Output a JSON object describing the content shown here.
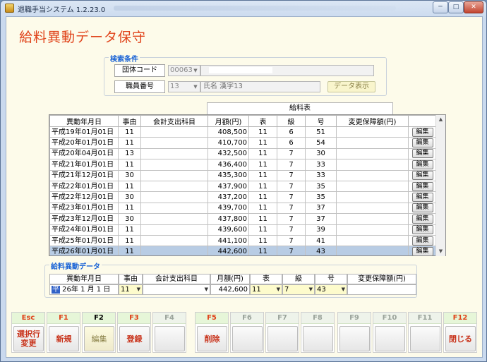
{
  "window": {
    "title": "退職手当システム 1.2.23.0",
    "close_glyph": "✕",
    "min_glyph": "─",
    "max_glyph": "□"
  },
  "page_title": "給料異動データ保守",
  "search": {
    "legend": "検索条件",
    "org_code_label": "団体コード",
    "org_code_value": "00063",
    "staff_no_label": "職員番号",
    "staff_no_value": "13",
    "staff_name": "氏名  漢字13",
    "show_button": "データ表示"
  },
  "table": {
    "group_header": "給料表",
    "columns": [
      "異動年月日",
      "事由",
      "会計支出科目",
      "月額(円)",
      "表",
      "級",
      "号",
      "変更保障額(円)",
      ""
    ],
    "edit_label": "編集",
    "rows": [
      [
        "平成19年01月01日",
        "11",
        "",
        "408,500",
        "11",
        "6",
        "51",
        ""
      ],
      [
        "平成20年01月01日",
        "11",
        "",
        "410,700",
        "11",
        "6",
        "54",
        ""
      ],
      [
        "平成20年04月01日",
        "13",
        "",
        "432,500",
        "11",
        "7",
        "30",
        ""
      ],
      [
        "平成21年01月01日",
        "11",
        "",
        "436,400",
        "11",
        "7",
        "33",
        ""
      ],
      [
        "平成21年12月01日",
        "30",
        "",
        "435,300",
        "11",
        "7",
        "33",
        ""
      ],
      [
        "平成22年01月01日",
        "11",
        "",
        "437,900",
        "11",
        "7",
        "35",
        ""
      ],
      [
        "平成22年12月01日",
        "30",
        "",
        "437,200",
        "11",
        "7",
        "35",
        ""
      ],
      [
        "平成23年01月01日",
        "11",
        "",
        "439,700",
        "11",
        "7",
        "37",
        ""
      ],
      [
        "平成23年12月01日",
        "30",
        "",
        "437,800",
        "11",
        "7",
        "37",
        ""
      ],
      [
        "平成24年01月01日",
        "11",
        "",
        "439,600",
        "11",
        "7",
        "39",
        ""
      ],
      [
        "平成25年01月01日",
        "11",
        "",
        "441,100",
        "11",
        "7",
        "41",
        ""
      ],
      [
        "平成26年01月01日",
        "11",
        "",
        "442,600",
        "11",
        "7",
        "43",
        ""
      ]
    ],
    "selected_row": 11
  },
  "edit": {
    "legend": "給料異動データ",
    "headers": [
      "異動年月日",
      "事由",
      "会計支出科目",
      "月額(円)",
      "表",
      "級",
      "号",
      "変更保障額(円)"
    ],
    "era_char": "平",
    "date_rest": " 26年 1 月 1 日",
    "reason": "11",
    "account": "",
    "monthly": "442,600",
    "hyo": "11",
    "kyu": "7",
    "go": "43",
    "guarantee": ""
  },
  "fkeys": [
    {
      "cap": "Esc",
      "label": "選択行\n変更",
      "state": "active"
    },
    {
      "cap": "F1",
      "label": "新規",
      "state": "active"
    },
    {
      "cap": "F2",
      "label": "編集",
      "state": "edit"
    },
    {
      "cap": "F3",
      "label": "登録",
      "state": "active"
    },
    {
      "cap": "F4",
      "label": "",
      "state": "inactive"
    },
    {
      "cap": "F5",
      "label": "削除",
      "state": "active"
    },
    {
      "cap": "F6",
      "label": "",
      "state": "inactive"
    },
    {
      "cap": "F7",
      "label": "",
      "state": "inactive"
    },
    {
      "cap": "F8",
      "label": "",
      "state": "inactive"
    },
    {
      "cap": "F9",
      "label": "",
      "state": "inactive"
    },
    {
      "cap": "F10",
      "label": "",
      "state": "inactive"
    },
    {
      "cap": "F11",
      "label": "",
      "state": "inactive"
    },
    {
      "cap": "F12",
      "label": "閉じる",
      "state": "active"
    }
  ],
  "colors": {
    "title": "#e0431a",
    "legend": "#1a63d6",
    "selected_row": "#b8cce4",
    "form_bg": "#fdfbea"
  }
}
